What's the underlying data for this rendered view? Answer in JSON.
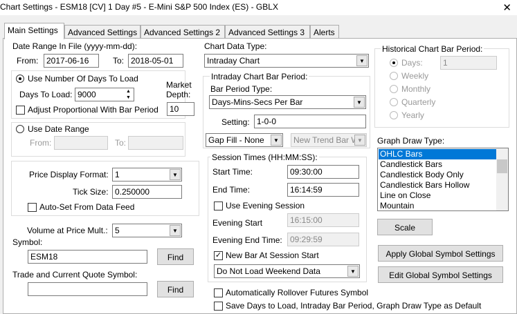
{
  "window": {
    "title": "Chart Settings - ESM18 [CV]  1 Day   #5 - E-Mini S&P 500 Index (ES) - GBLX",
    "close": "✕"
  },
  "tabs": [
    "Main Settings",
    "Advanced Settings",
    "Advanced Settings 2",
    "Advanced Settings 3",
    "Alerts"
  ],
  "date_range": {
    "label": "Date Range In File (yyyy-mm-dd):",
    "from_label": "From:",
    "from": "2017-06-16",
    "to_label": "To:",
    "to": "2018-05-01"
  },
  "days": {
    "use_label": "Use Number Of Days To Load",
    "days_label": "Days To Load:",
    "days": "9000",
    "market_depth_label": "Market Depth:",
    "market_depth": "10",
    "adjust_label": "Adjust Proportional With Bar Period"
  },
  "date_range_opt": {
    "label": "Use Date Range",
    "from_label": "From:",
    "to_label": "To:"
  },
  "price": {
    "format_label": "Price Display Format:",
    "format": "1",
    "tick_label": "Tick Size:",
    "tick": "0.250000",
    "autoset_label": "Auto-Set From Data Feed"
  },
  "volume": {
    "label": "Volume at Price Mult.:",
    "value": "5"
  },
  "symbol": {
    "label": "Symbol:",
    "value": "ESM18",
    "find": "Find",
    "trade_label": "Trade and Current Quote Symbol:",
    "trade_value": "",
    "find2": "Find"
  },
  "chart_type": {
    "label": "Chart Data Type:",
    "value": "Intraday Chart"
  },
  "intraday": {
    "label": "Intraday Chart Bar Period:",
    "period_type_label": "Bar Period Type:",
    "period_type": "Days-Mins-Secs Per Bar",
    "setting_label": "Setting:",
    "setting": "1-0-0",
    "gap_fill": "Gap Fill - None",
    "new_trend": "New Trend Bar W"
  },
  "session": {
    "label": "Session Times (HH:MM:SS):",
    "start_label": "Start Time:",
    "start": "09:30:00",
    "end_label": "End Time:",
    "end": "16:14:59",
    "evening_label": "Use Evening Session",
    "evening_start_label": "Evening Start",
    "evening_start": "16:15:00",
    "evening_end_label": "Evening End Time:",
    "evening_end": "09:29:59",
    "new_bar_label": "New Bar At Session Start",
    "weekend": "Do Not Load Weekend Data"
  },
  "historical": {
    "label": "Historical Chart Bar Period:",
    "days_label": "Days:",
    "days": "1",
    "options": [
      "Weekly",
      "Monthly",
      "Quarterly",
      "Yearly"
    ]
  },
  "graph": {
    "label": "Graph Draw Type:",
    "items": [
      "OHLC Bars",
      "Candlestick Bars",
      "Candlestick Body Only",
      "Candlestick Bars Hollow",
      "Line on Close",
      "Mountain"
    ]
  },
  "buttons": {
    "scale": "Scale",
    "apply_global": "Apply Global Symbol Settings",
    "edit_global": "Edit Global Symbol Settings"
  },
  "bottom": {
    "rollover": "Automatically Rollover Futures Symbol",
    "save_default": "Save Days to Load, Intraday Bar Period, Graph Draw Type as Default"
  }
}
